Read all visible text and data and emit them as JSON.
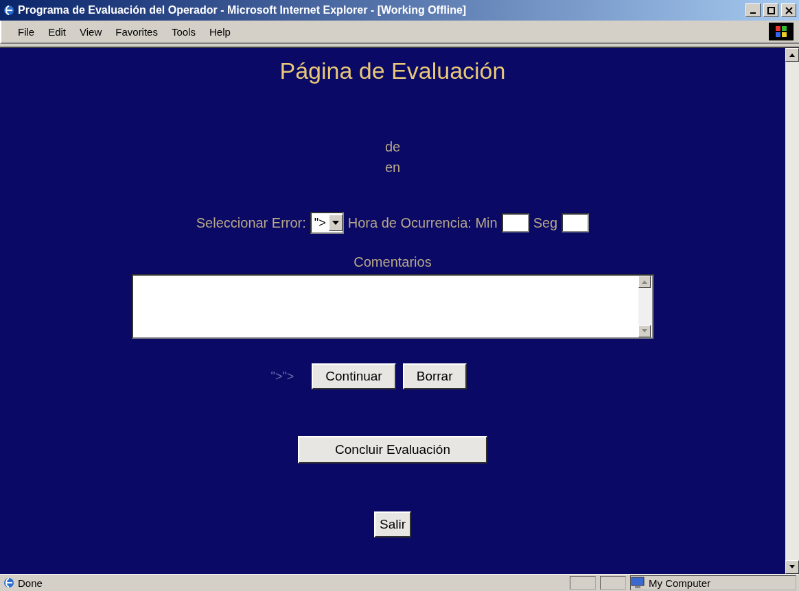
{
  "window": {
    "title": "Programa de Evaluación del Operador - Microsoft Internet Explorer - [Working Offline]"
  },
  "menu": [
    "File",
    "Edit",
    "View",
    "Favorites",
    "Tools",
    "Help"
  ],
  "page": {
    "heading": "Página de Evaluación",
    "line_1": "de",
    "line_2": "en",
    "error_label": "Seleccionar Error:",
    "error_select": {
      "value": "\">"
    },
    "time_label": "Hora de Ocurrencia: Min",
    "seconds_label": "Seg",
    "comments_label": "Comentarios",
    "stray_text": "\">\">",
    "buttons": [
      "Continuar",
      "Borrar"
    ],
    "conclude_button": "Concluir Evaluación",
    "exit_button": "Salir"
  },
  "status_bar": {
    "status": "Done",
    "zone": "My Computer"
  }
}
